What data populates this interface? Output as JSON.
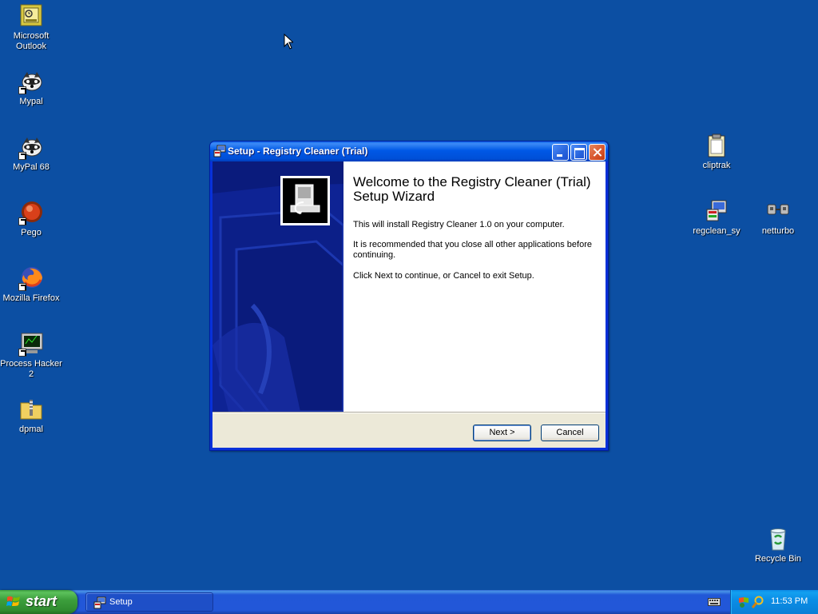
{
  "desktop": {
    "background_color": "#0c4fa3",
    "icons_left": [
      {
        "label": "Microsoft Outlook",
        "icon": "outlook-icon"
      },
      {
        "label": "Mypal",
        "icon": "mypal-icon"
      },
      {
        "label": "MyPal 68",
        "icon": "mypal68-icon"
      },
      {
        "label": "Pego",
        "icon": "pego-icon"
      },
      {
        "label": "Mozilla Firefox",
        "icon": "firefox-icon"
      },
      {
        "label": "Process Hacker 2",
        "icon": "process-hacker-icon"
      },
      {
        "label": "dpmal",
        "icon": "zip-folder-icon"
      }
    ],
    "icons_right": [
      {
        "label": "cliptrak",
        "icon": "clipboard-icon"
      },
      {
        "label": "regclean_sy",
        "icon": "installer-icon"
      },
      {
        "label": "netturbo",
        "icon": "network-icon"
      },
      {
        "label": "Recycle Bin",
        "icon": "recycle-bin-icon"
      }
    ]
  },
  "window": {
    "title": "Setup - Registry Cleaner (Trial)",
    "welcome_title": "Welcome to the Registry Cleaner (Trial) Setup Wizard",
    "paragraphs": [
      "This will install Registry Cleaner 1.0 on your computer.",
      "It is recommended that you close all other applications before continuing.",
      "Click Next to continue, or Cancel to exit Setup."
    ],
    "buttons": {
      "next": "Next >",
      "cancel": "Cancel"
    },
    "colors": {
      "titlebar": "#0058e6",
      "side_panel": "#0a1b7c",
      "close_button": "#d7542b"
    }
  },
  "taskbar": {
    "start_label": "start",
    "task_label": "Setup",
    "clock": "11:53 PM"
  }
}
